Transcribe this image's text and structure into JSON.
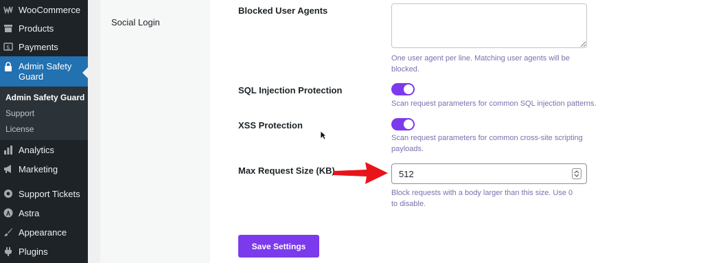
{
  "sidebar": {
    "items": [
      {
        "label": "WooCommerce",
        "icon": "woocommerce-icon"
      },
      {
        "label": "Products",
        "icon": "products-icon"
      },
      {
        "label": "Payments",
        "icon": "payments-icon"
      },
      {
        "label": "Admin Safety Guard",
        "icon": "lock-icon",
        "active": true
      },
      {
        "label": "Analytics",
        "icon": "analytics-icon"
      },
      {
        "label": "Marketing",
        "icon": "megaphone-icon"
      },
      {
        "label": "Support Tickets",
        "icon": "support-icon"
      },
      {
        "label": "Astra",
        "icon": "astra-icon"
      },
      {
        "label": "Appearance",
        "icon": "paintbrush-icon"
      },
      {
        "label": "Plugins",
        "icon": "plugin-icon"
      }
    ],
    "submenu": [
      {
        "label": "Admin Safety Guard",
        "current": true
      },
      {
        "label": "Support"
      },
      {
        "label": "License"
      }
    ]
  },
  "settings_nav": {
    "social_login": "Social Login"
  },
  "form": {
    "blocked_agents": {
      "label": "Blocked User Agents",
      "value": "",
      "description": "One user agent per line. Matching user agents will be blocked."
    },
    "sql_injection": {
      "label": "SQL Injection Protection",
      "enabled": true,
      "description": "Scan request parameters for common SQL injection patterns."
    },
    "xss": {
      "label": "XSS Protection",
      "enabled": true,
      "description": "Scan request parameters for common cross-site scripting payloads."
    },
    "max_request": {
      "label": "Max Request Size (KB)",
      "value": "512",
      "description": "Block requests with a body larger than this size. Use 0 to disable."
    },
    "save_label": "Save Settings"
  },
  "colors": {
    "sidebar_bg": "#1d2327",
    "active_item": "#2271b1",
    "accent_purple": "#7c3aed",
    "description_text": "#7c6fae",
    "annotation_arrow": "#e8141a"
  }
}
